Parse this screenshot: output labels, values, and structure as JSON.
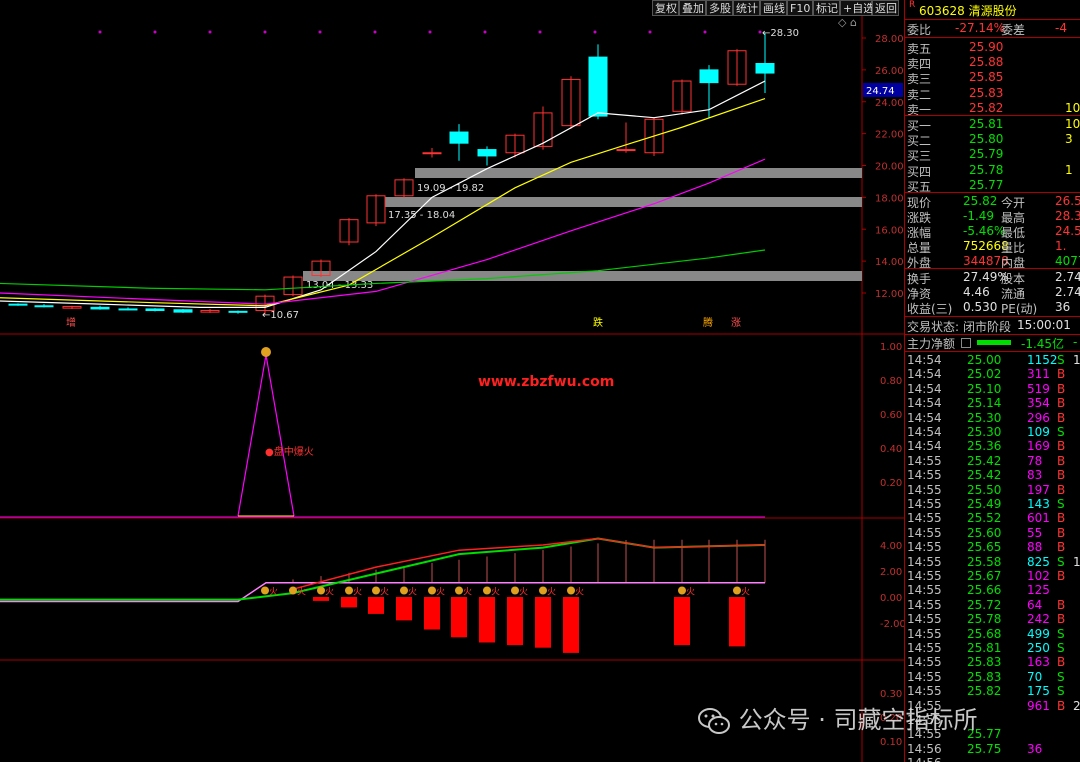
{
  "toolbar": [
    "复权",
    "叠加",
    "多股",
    "统计",
    "画线",
    "F10",
    "标记",
    "+自选",
    "返回"
  ],
  "header": {
    "code_name": "603628 清源股份",
    "r_mark": "R"
  },
  "order_book": {
    "wei_bi_label": "委比",
    "wei_bi": "-27.14%",
    "wei_cha_label": "委差",
    "wei_cha": "-4",
    "asks": [
      {
        "label": "卖五",
        "price": "25.90",
        "vol": ""
      },
      {
        "label": "卖四",
        "price": "25.88",
        "vol": ""
      },
      {
        "label": "卖三",
        "price": "25.85",
        "vol": ""
      },
      {
        "label": "卖二",
        "price": "25.83",
        "vol": ""
      },
      {
        "label": "卖一",
        "price": "25.82",
        "vol": "10"
      }
    ],
    "bids": [
      {
        "label": "买一",
        "price": "25.81",
        "vol": "10"
      },
      {
        "label": "买二",
        "price": "25.80",
        "vol": "3"
      },
      {
        "label": "买三",
        "price": "25.79",
        "vol": ""
      },
      {
        "label": "买四",
        "price": "25.78",
        "vol": "1"
      },
      {
        "label": "买五",
        "price": "25.77",
        "vol": ""
      }
    ]
  },
  "quote": [
    {
      "l1": "现价",
      "v1": "25.82",
      "l2": "今开",
      "v2": "26.5"
    },
    {
      "l1": "涨跌",
      "v1": "-1.49",
      "l2": "最高",
      "v2": "28.3"
    },
    {
      "l1": "涨幅",
      "v1": "-5.46%",
      "l2": "最低",
      "v2": "24.5"
    },
    {
      "l1": "总量",
      "v1": "752668",
      "l2": "量比",
      "v2": "1."
    },
    {
      "l1": "外盘",
      "v1": "344878",
      "l2": "内盘",
      "v2": "40779"
    }
  ],
  "stats": [
    {
      "l1": "换手",
      "v1": "27.49%",
      "l2": "股本",
      "v2": "2.74"
    },
    {
      "l1": "净资",
      "v1": "4.46",
      "l2": "流通",
      "v2": "2.74"
    },
    {
      "l1": "收益(三)",
      "v1": "0.530",
      "l2": "PE(动)",
      "v2": "36"
    }
  ],
  "trade_status": {
    "label": "交易状态:",
    "value": "闭市阶段",
    "time": "15:00:01"
  },
  "main_flow": {
    "label": "主力净额",
    "value": "-1.45亿",
    "extra": "-"
  },
  "ticks": [
    [
      "14:54",
      "25.00",
      "1152",
      "S",
      "1"
    ],
    [
      "14:54",
      "25.02",
      "311",
      "B",
      ""
    ],
    [
      "14:54",
      "25.10",
      "519",
      "B",
      ""
    ],
    [
      "14:54",
      "25.14",
      "354",
      "B",
      ""
    ],
    [
      "14:54",
      "25.30",
      "296",
      "B",
      ""
    ],
    [
      "14:54",
      "25.30",
      "109",
      "S",
      ""
    ],
    [
      "14:54",
      "25.36",
      "169",
      "B",
      ""
    ],
    [
      "14:55",
      "25.42",
      "78",
      "B",
      ""
    ],
    [
      "14:55",
      "25.42",
      "83",
      "B",
      ""
    ],
    [
      "14:55",
      "25.50",
      "197",
      "B",
      ""
    ],
    [
      "14:55",
      "25.49",
      "143",
      "S",
      ""
    ],
    [
      "14:55",
      "25.52",
      "601",
      "B",
      ""
    ],
    [
      "14:55",
      "25.60",
      "55",
      "B",
      ""
    ],
    [
      "14:55",
      "25.65",
      "88",
      "B",
      ""
    ],
    [
      "14:55",
      "25.58",
      "825",
      "S",
      "1"
    ],
    [
      "14:55",
      "25.67",
      "102",
      "B",
      ""
    ],
    [
      "14:55",
      "25.66",
      "125",
      "",
      ""
    ],
    [
      "14:55",
      "25.72",
      "64",
      "B",
      ""
    ],
    [
      "14:55",
      "25.78",
      "242",
      "B",
      ""
    ],
    [
      "14:55",
      "25.68",
      "499",
      "S",
      ""
    ],
    [
      "14:55",
      "25.81",
      "250",
      "S",
      ""
    ],
    [
      "14:55",
      "25.83",
      "163",
      "B",
      ""
    ],
    [
      "14:55",
      "25.83",
      "70",
      "S",
      ""
    ],
    [
      "14:55",
      "25.82",
      "175",
      "S",
      ""
    ],
    [
      "14:55",
      "",
      "961",
      "B",
      "2"
    ],
    [
      "14:55",
      "",
      "",
      "",
      ""
    ],
    [
      "14:55",
      "25.77",
      "",
      "",
      ""
    ],
    [
      "14:56",
      "25.75",
      "36",
      "",
      ""
    ],
    [
      "14:56",
      "",
      "",
      "",
      ""
    ]
  ],
  "axis_main": [
    "28.00",
    "26.00",
    "24.00",
    "22.00",
    "20.00",
    "18.00",
    "16.00",
    "14.00",
    "12.00"
  ],
  "price_tag": "24.74",
  "axis_ind1": [
    "1.00",
    "0.80",
    "0.60",
    "0.40",
    "0.20"
  ],
  "axis_ind2": [
    "4.00",
    "2.00",
    "0.00",
    "-2.00"
  ],
  "axis_ind3": [
    "0.30",
    "0.20",
    "0.10"
  ],
  "annotations": {
    "high": "28.30",
    "low": "10.67",
    "zone1": "19.09 - 19.82",
    "zone2": "17.35 - 18.04",
    "zone3": "13.04 - 13.33",
    "label_zeng": "增",
    "label_die": "跌",
    "label_teng": "腾",
    "label_zhang": "涨",
    "site": "www.zbzfwu.com",
    "ind1_label": "●盘中爆火",
    "ind2_word": "火"
  },
  "watermark": "公众号 · 司藏空指标所",
  "colors": {
    "up": "#ff3333",
    "down": "#00ffff",
    "ma5": "#ffffff",
    "ma10": "#ffff00",
    "ma20": "#ff00ff",
    "ma60": "#00cc00"
  }
}
